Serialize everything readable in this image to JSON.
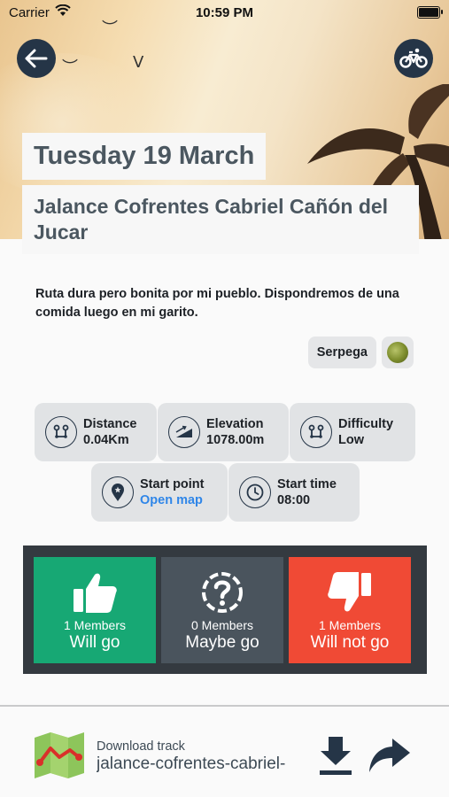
{
  "status_bar": {
    "carrier": "Carrier",
    "time": "10:59 PM"
  },
  "event": {
    "date": "Tuesday 19 March",
    "title": "Jalance Cofrentes Cabriel Cañón del Jucar",
    "description": "Ruta dura pero bonita por mi pueblo. Dispondremos de una comida luego en mi garito.",
    "author": "Serpega"
  },
  "stats": {
    "distance": {
      "label": "Distance",
      "value": "0.04Km"
    },
    "elevation": {
      "label": "Elevation",
      "value": "1078.00m"
    },
    "difficulty": {
      "label": "Difficulty",
      "value": "Low"
    },
    "start_point": {
      "label": "Start point",
      "value": "Open map"
    },
    "start_time": {
      "label": "Start time",
      "value": "08:00"
    }
  },
  "votes": {
    "go": {
      "count": "1 Members",
      "label": "Will go",
      "color": "#17a874"
    },
    "maybe": {
      "count": "0 Members",
      "label": "Maybe go",
      "color": "#4a545d"
    },
    "not_go": {
      "count": "1 Members",
      "label": "Will not go",
      "color": "#f04a35"
    }
  },
  "download": {
    "label": "Download track",
    "filename": "jalance-cofrentes-cabriel-"
  },
  "icons": [
    "back-arrow-icon",
    "bicycle-icon",
    "route-icon",
    "elevation-icon",
    "difficulty-icon",
    "location-pin-icon",
    "clock-icon",
    "thumbs-up-icon",
    "question-icon",
    "thumbs-down-icon",
    "map-icon",
    "download-icon",
    "share-icon"
  ]
}
